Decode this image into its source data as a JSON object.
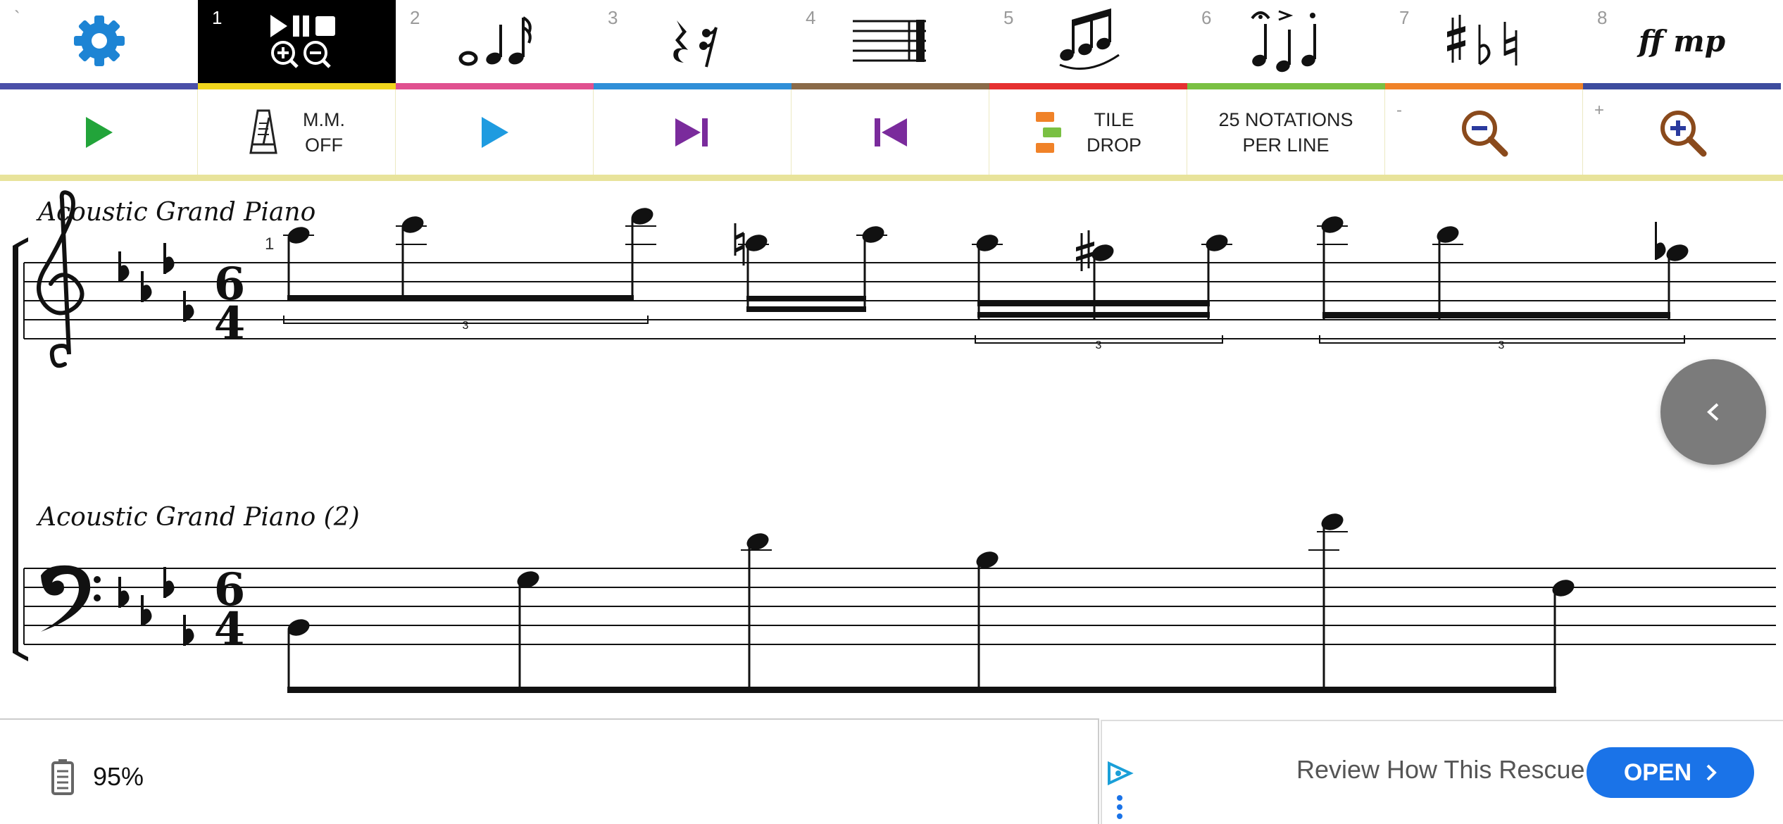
{
  "toolbar": {
    "tabs": [
      {
        "num": "`",
        "icon": "gear-icon",
        "color": "#4a4fa8"
      },
      {
        "num": "1",
        "icon": "transport-zoom-icon",
        "color": "#f0d51c",
        "active": true
      },
      {
        "num": "2",
        "icon": "note-durations-icon",
        "color": "#e0508f"
      },
      {
        "num": "3",
        "icon": "rests-icon",
        "color": "#2f8fd8"
      },
      {
        "num": "4",
        "icon": "barlines-icon",
        "color": "#8a6a48"
      },
      {
        "num": "5",
        "icon": "beamed-notes-icon",
        "color": "#e53030"
      },
      {
        "num": "6",
        "icon": "articulations-icon",
        "color": "#7ac043"
      },
      {
        "num": "7",
        "icon": "accidentals-icon",
        "color": "#f08228"
      },
      {
        "num": "8",
        "icon": "dynamics-icon",
        "color": "#3d4c9e",
        "label": "ff mp"
      }
    ],
    "controls": {
      "play_color": "#22a43a",
      "mm_label_1": "M.M.",
      "mm_label_2": "OFF",
      "play_from_color": "#1e9be0",
      "skip_color": "#7a2b9c",
      "tile_label_1": "TILE",
      "tile_label_2": "DROP",
      "notations_label_1": "25 NOTATIONS",
      "notations_label_2": "PER LINE",
      "zoom_out_mini": "-",
      "zoom_in_mini": "+",
      "zoom_color": "#8a4a1c"
    }
  },
  "score": {
    "staff1": {
      "instrument": "Acoustic Grand Piano",
      "measure_number": "1",
      "time_sig_top": "6",
      "time_sig_bottom": "4",
      "tuplet": "3"
    },
    "staff2": {
      "instrument": "Acoustic Grand Piano (2)",
      "time_sig_top": "6",
      "time_sig_bottom": "4"
    }
  },
  "status": {
    "battery": "95%"
  },
  "ad": {
    "text": "Review How This Rescue",
    "button": "OPEN"
  }
}
